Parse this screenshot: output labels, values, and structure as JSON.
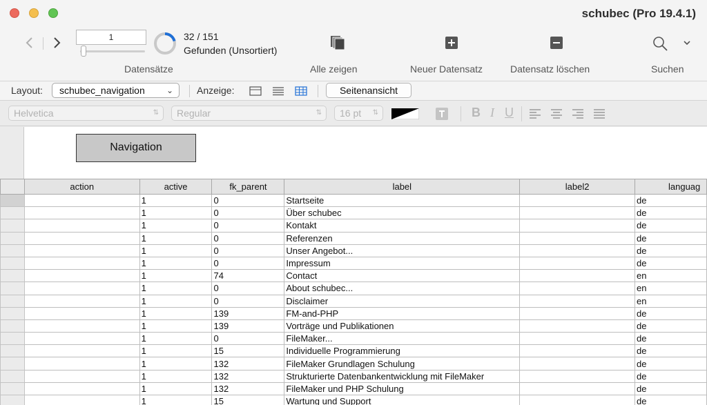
{
  "window": {
    "title": "schubec (Pro 19.4.1)"
  },
  "toolbar": {
    "record_number": "1",
    "found_count": "32 / 151",
    "found_status": "Gefunden (Unsortiert)",
    "found_fraction": 0.21,
    "records_label": "Datensätze",
    "show_all_label": "Alle zeigen",
    "new_record_label": "Neuer Datensatz",
    "delete_record_label": "Datensatz löschen",
    "search_label": "Suchen"
  },
  "layoutbar": {
    "layout_label": "Layout:",
    "layout_value": "schubec_navigation",
    "view_label": "Anzeige:",
    "preview_button": "Seitenansicht"
  },
  "formatbar": {
    "font": "Helvetica",
    "style": "Regular",
    "size": "16 pt",
    "bold": "B",
    "italic": "I",
    "underline": "U"
  },
  "header": {
    "navigation_button": "Navigation"
  },
  "table": {
    "columns": [
      "action",
      "active",
      "fk_parent",
      "label",
      "label2",
      "languag"
    ],
    "rows": [
      [
        "",
        "1",
        "0",
        "Startseite",
        "",
        "de"
      ],
      [
        "",
        "1",
        "0",
        "Über schubec",
        "",
        "de"
      ],
      [
        "",
        "1",
        "0",
        "Kontakt",
        "",
        "de"
      ],
      [
        "",
        "1",
        "0",
        "Referenzen",
        "",
        "de"
      ],
      [
        "",
        "1",
        "0",
        "Unser Angebot...",
        "",
        "de"
      ],
      [
        "",
        "1",
        "0",
        "Impressum",
        "",
        "de"
      ],
      [
        "",
        "1",
        "74",
        "Contact",
        "",
        "en"
      ],
      [
        "",
        "1",
        "0",
        "About schubec...",
        "",
        "en"
      ],
      [
        "",
        "1",
        "0",
        "Disclaimer",
        "",
        "en"
      ],
      [
        "",
        "1",
        "139",
        "FM-and-PHP",
        "",
        "de"
      ],
      [
        "",
        "1",
        "139",
        "Vorträge und Publikationen",
        "",
        "de"
      ],
      [
        "",
        "1",
        "0",
        "FileMaker...",
        "",
        "de"
      ],
      [
        "",
        "1",
        "15",
        "Individuelle Programmierung",
        "",
        "de"
      ],
      [
        "",
        "1",
        "132",
        "FileMaker Grundlagen Schulung",
        "",
        "de"
      ],
      [
        "",
        "1",
        "132",
        "Strukturierte Datenbankentwicklung mit FileMaker",
        "",
        "de"
      ],
      [
        "",
        "1",
        "132",
        "FileMaker und PHP Schulung",
        "",
        "de"
      ],
      [
        "",
        "1",
        "15",
        "Wartung und Support",
        "",
        "de"
      ]
    ]
  },
  "icons": {
    "show_all": "stacked-pages-icon",
    "new_record": "plus-square-icon",
    "delete_record": "minus-square-icon",
    "search": "magnifier-icon",
    "accent": "#1f6fd6"
  }
}
